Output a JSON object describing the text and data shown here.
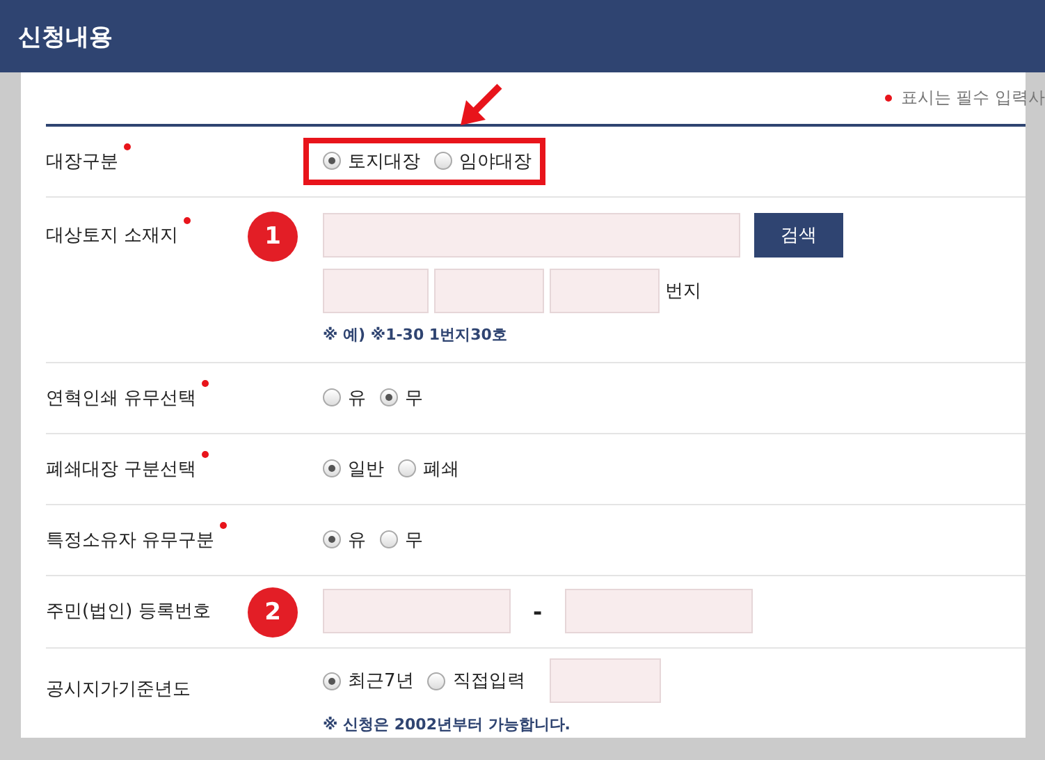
{
  "header": {
    "title": "신청내용"
  },
  "required_note": "표시는 필수 입력사",
  "rows": [
    {
      "kind": "radio",
      "label": "대장구분",
      "required": true,
      "highlighted": true,
      "options": [
        {
          "label": "토지대장",
          "selected": true
        },
        {
          "label": "임야대장",
          "selected": false
        }
      ]
    },
    {
      "kind": "address",
      "label": "대상토지 소재지",
      "required": true,
      "badge": "1",
      "search_button": "검색",
      "unit": "번지",
      "hint": "※ 예) ※1-30 1번지30호"
    },
    {
      "kind": "radio",
      "label": "연혁인쇄 유무선택",
      "required": true,
      "highlighted": false,
      "options": [
        {
          "label": "유",
          "selected": false
        },
        {
          "label": "무",
          "selected": true
        }
      ]
    },
    {
      "kind": "radio",
      "label": "폐쇄대장 구분선택",
      "required": true,
      "highlighted": false,
      "options": [
        {
          "label": "일반",
          "selected": true
        },
        {
          "label": "폐쇄",
          "selected": false
        }
      ]
    },
    {
      "kind": "radio",
      "label": "특정소유자 유무구분",
      "required": true,
      "highlighted": false,
      "options": [
        {
          "label": "유",
          "selected": true
        },
        {
          "label": "무",
          "selected": false
        }
      ]
    },
    {
      "kind": "id_number",
      "label": "주민(법인) 등록번호",
      "required": false,
      "badge": "2",
      "separator": "-"
    },
    {
      "kind": "year",
      "label": "공시지가기준년도",
      "required": false,
      "options": [
        {
          "label": "최근7년",
          "selected": true
        },
        {
          "label": "직접입력",
          "selected": false
        }
      ],
      "hint": "※ 신청은 2002년부터 가능합니다."
    }
  ]
}
